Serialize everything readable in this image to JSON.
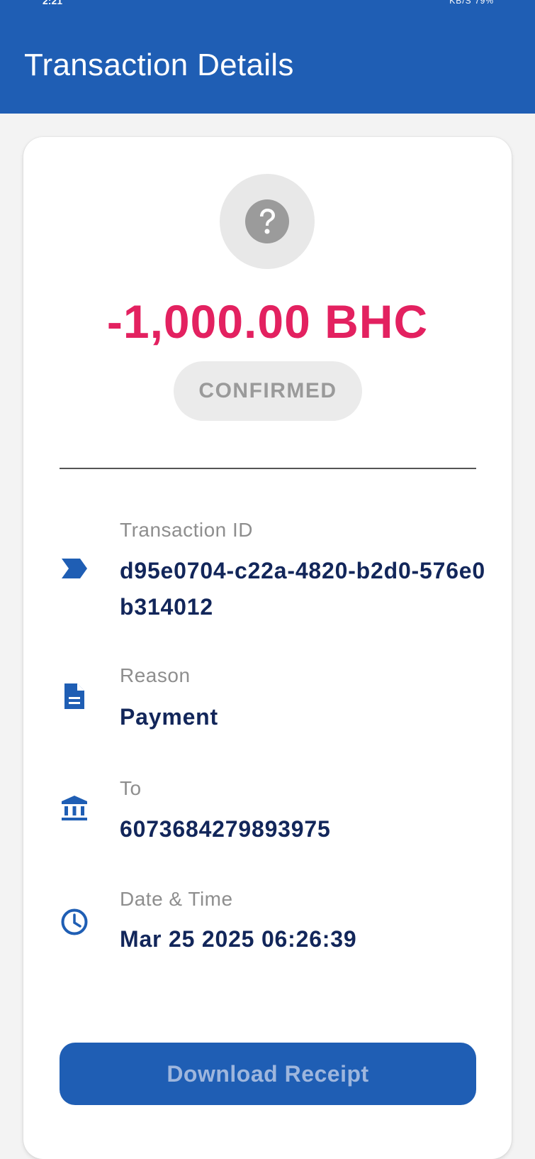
{
  "status_bar": {
    "time": "2:21",
    "network_speed": "KB/S",
    "battery": "79%"
  },
  "header": {
    "title": "Transaction Details"
  },
  "transaction": {
    "status_icon": "question-mark-icon",
    "amount": "-1,000.00 BHC",
    "status": "CONFIRMED"
  },
  "details": {
    "transaction_id": {
      "label": "Transaction ID",
      "value": "d95e0704-c22a-4820-b2d0-576e0b314012",
      "icon": "label-tag-icon"
    },
    "reason": {
      "label": "Reason",
      "value": "Payment",
      "icon": "document-icon"
    },
    "to": {
      "label": "To",
      "value": "6073684279893975",
      "icon": "bank-icon"
    },
    "date_time": {
      "label": "Date & Time",
      "value": "Mar 25 2025 06:26:39",
      "icon": "clock-icon"
    }
  },
  "actions": {
    "download_label": "Download Receipt"
  },
  "colors": {
    "primary": "#1f5eb4",
    "amount_negative": "#e32160",
    "value_text": "#12265a",
    "label_text": "#8e8e8e",
    "background": "#f3f3f3"
  }
}
